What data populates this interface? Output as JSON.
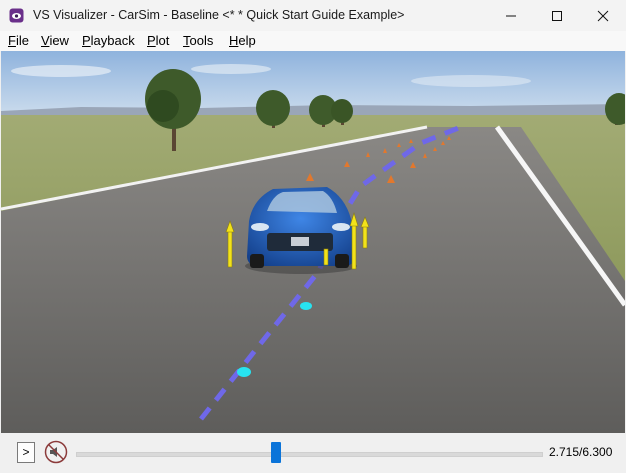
{
  "window": {
    "title": "VS Visualizer - CarSim - Baseline <* * Quick Start Guide Example>",
    "icon": "vs-visualizer-app-icon"
  },
  "menu": {
    "items": [
      {
        "label": "File",
        "accel": "F",
        "rest": "ile"
      },
      {
        "label": "View",
        "accel": "V",
        "rest": "iew"
      },
      {
        "label": "Playback",
        "accel": "P",
        "rest": "layback"
      },
      {
        "label": "Plot",
        "accel": "P",
        "rest": "lot"
      },
      {
        "label": "Tools",
        "accel": "T",
        "rest": "ools"
      },
      {
        "label": "Help",
        "accel": "H",
        "rest": "elp"
      }
    ]
  },
  "scene": {
    "description_icons": [
      "trees",
      "traffic-cones",
      "blue-sedan",
      "force-arrows",
      "path-trace"
    ],
    "colors": {
      "sky": "#a7c3e2",
      "grass": "#8f9b5e",
      "road": "#6e6d6b",
      "car": "#1e63c4",
      "force_arrow": "#f2e21a",
      "path": "#6f68e8",
      "path_marker": "#27e3f0",
      "cone": "#e2782d"
    }
  },
  "playback": {
    "play_label": ">",
    "mute_icon": "sound-off-icon",
    "progress": 0.431,
    "current_time": "2.715",
    "total_time": "6.300",
    "time_readout": "2.715/6.300"
  }
}
